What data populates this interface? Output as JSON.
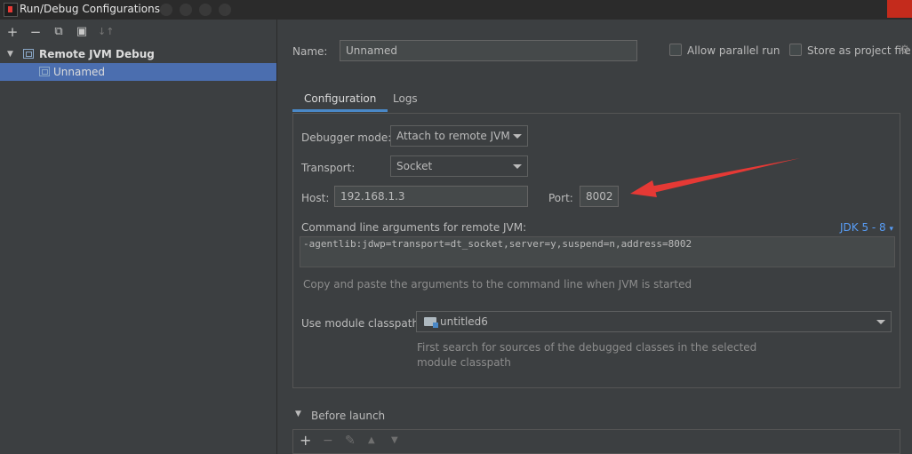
{
  "window": {
    "title": "Run/Debug Configurations"
  },
  "toolbar": {
    "add": "+",
    "remove": "−",
    "copy": "⧉",
    "folder": "▣",
    "sort": "↓↑"
  },
  "tree": {
    "group_label": "Remote JVM Debug",
    "item_label": "Unnamed"
  },
  "name_row": {
    "name_label": "Name:",
    "name_value": "Unnamed",
    "allow_parallel_label": "Allow parallel run",
    "store_project_label": "Store as project file"
  },
  "tabs": [
    {
      "label": "Configuration"
    },
    {
      "label": "Logs"
    }
  ],
  "config": {
    "debugger_mode_label": "Debugger mode:",
    "debugger_mode_value": "Attach to remote JVM",
    "transport_label": "Transport:",
    "transport_value": "Socket",
    "host_label": "Host:",
    "host_value": "192.168.1.3",
    "port_label": "Port:",
    "port_value": "8002",
    "cmd_label": "Command line arguments for remote JVM:",
    "jdk_link": "JDK 5 - 8",
    "cmd_value": "-agentlib:jdwp=transport=dt_socket,server=y,suspend=n,address=8002",
    "cmd_hint": "Copy and paste the arguments to the command line when JVM is started",
    "classpath_label": "Use module classpath:",
    "classpath_value": "untitled6",
    "classpath_hint_1": "First search for sources of the debugged classes in the selected",
    "classpath_hint_2": "module classpath"
  },
  "before_launch": {
    "label": "Before launch",
    "add": "+",
    "remove": "−",
    "edit": "✎",
    "up": "▲",
    "down": "▼"
  },
  "colors": {
    "background": "#3c3f41",
    "selection": "#4b6eaf",
    "accent": "#4a88c7",
    "link": "#589df6",
    "annotation_arrow": "#e53935"
  }
}
